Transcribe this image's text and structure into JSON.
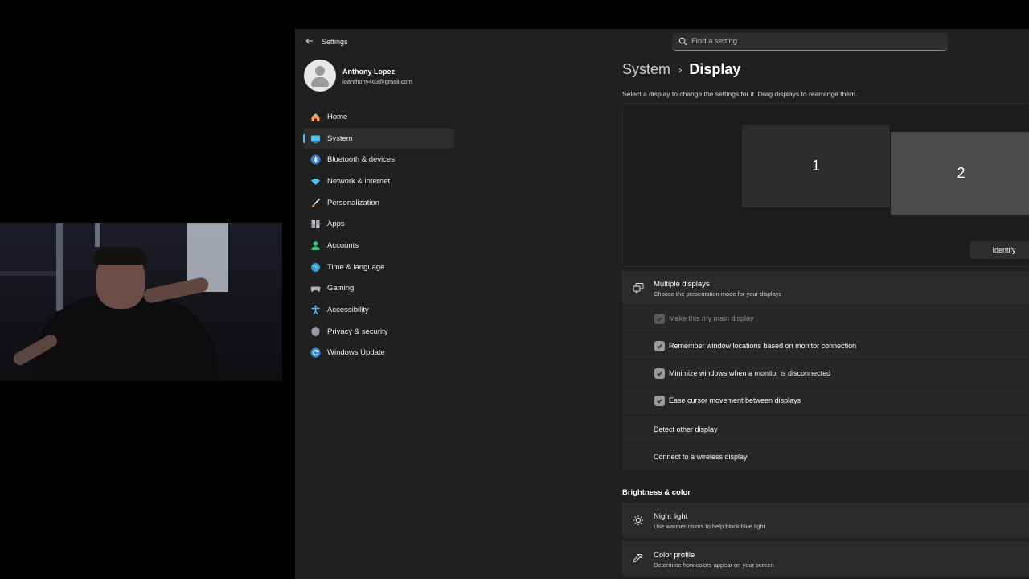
{
  "window": {
    "title": "Settings",
    "search_placeholder": "Find a setting"
  },
  "profile": {
    "name": "Anthony Lopez",
    "email": "loanthony463@gmail.com"
  },
  "nav": {
    "items": [
      {
        "label": "Home",
        "icon": "home-icon"
      },
      {
        "label": "System",
        "icon": "system-icon"
      },
      {
        "label": "Bluetooth & devices",
        "icon": "bluetooth-icon"
      },
      {
        "label": "Network & internet",
        "icon": "network-icon"
      },
      {
        "label": "Personalization",
        "icon": "brush-icon"
      },
      {
        "label": "Apps",
        "icon": "apps-icon"
      },
      {
        "label": "Accounts",
        "icon": "accounts-icon"
      },
      {
        "label": "Time & language",
        "icon": "globe-icon"
      },
      {
        "label": "Gaming",
        "icon": "gaming-icon"
      },
      {
        "label": "Accessibility",
        "icon": "accessibility-icon"
      },
      {
        "label": "Privacy & security",
        "icon": "shield-icon"
      },
      {
        "label": "Windows Update",
        "icon": "update-icon"
      }
    ],
    "active": "System"
  },
  "main": {
    "breadcrumb_parent": "System",
    "breadcrumb_sep": "›",
    "breadcrumb_current": "Display",
    "intro": "Select a display to change the settings for it. Drag displays to rearrange them.",
    "monitors": [
      "1",
      "2"
    ],
    "identify_label": "Identify",
    "multiple_displays": {
      "title": "Multiple displays",
      "subtitle": "Choose the presentation mode for your displays"
    },
    "options": [
      {
        "label": "Make this my main display",
        "checked": true,
        "disabled": true
      },
      {
        "label": "Remember window locations based on monitor connection",
        "checked": true,
        "disabled": false
      },
      {
        "label": "Minimize windows when a monitor is disconnected",
        "checked": true,
        "disabled": false
      },
      {
        "label": "Ease cursor movement between displays",
        "checked": true,
        "disabled": false
      }
    ],
    "detect_label": "Detect other display",
    "wireless_label": "Connect to a wireless display",
    "brightness_heading": "Brightness & color",
    "night_light": {
      "title": "Night light",
      "subtitle": "Use warmer colors to help block blue light"
    },
    "color_profile": {
      "title": "Color profile",
      "subtitle": "Determine how colors appear on your screen"
    }
  },
  "colors": {
    "accent": "#4cc2ff",
    "background": "#202020",
    "card": "#2b2b2b"
  }
}
